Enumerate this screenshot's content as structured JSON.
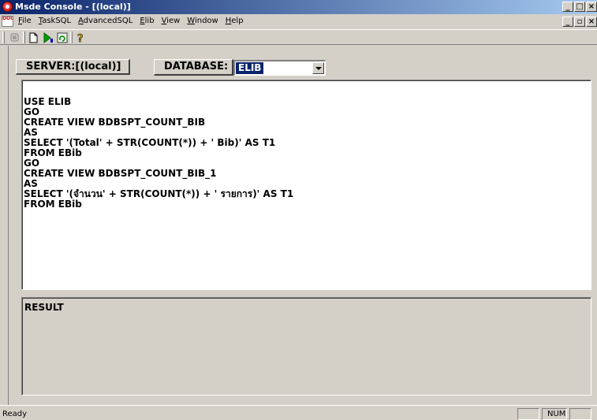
{
  "window": {
    "title": "Msde Console - [(local)]",
    "controls": {
      "minimize": "_",
      "restore": "□",
      "close": "×"
    },
    "mdi_controls": {
      "minimize": "_",
      "restore": "▫",
      "close": "×"
    }
  },
  "menu": {
    "items": [
      {
        "label": "File",
        "mnemonic": "F"
      },
      {
        "label": "TaskSQL",
        "mnemonic": "T"
      },
      {
        "label": "AdvancedSQL",
        "mnemonic": "A"
      },
      {
        "label": "Elib",
        "mnemonic": "E"
      },
      {
        "label": "View",
        "mnemonic": "V"
      },
      {
        "label": "Window",
        "mnemonic": "W"
      },
      {
        "label": "Help",
        "mnemonic": "H"
      }
    ]
  },
  "toolbar": {
    "buttons": [
      "stop-icon",
      "new-document-icon",
      "run-query-icon",
      "refresh-icon",
      "help-icon"
    ]
  },
  "server": {
    "label": "SERVER:[(local)]"
  },
  "database": {
    "label": "DATABASE:",
    "selected": "ELIB"
  },
  "editor": {
    "lines": [
      "USE ELIB",
      "GO",
      "CREATE VIEW BDBSPT_COUNT_BIB",
      "AS",
      "SELECT '(Total' + STR(COUNT(*)) + ' Bib)' AS T1",
      "FROM EBib",
      "GO",
      "CREATE VIEW BDBSPT_COUNT_BIB_1",
      "AS",
      "SELECT '(จำนวน' + STR(COUNT(*)) + ' รายการ)' AS T1",
      "FROM EBib"
    ]
  },
  "result": {
    "label": "RESULT"
  },
  "status": {
    "text": "Ready",
    "num": "NUM"
  },
  "colors": {
    "titlebar_start": "#0a246a",
    "titlebar_end": "#a6caf0",
    "face": "#d4d0c8",
    "selection": "#0a246a"
  }
}
